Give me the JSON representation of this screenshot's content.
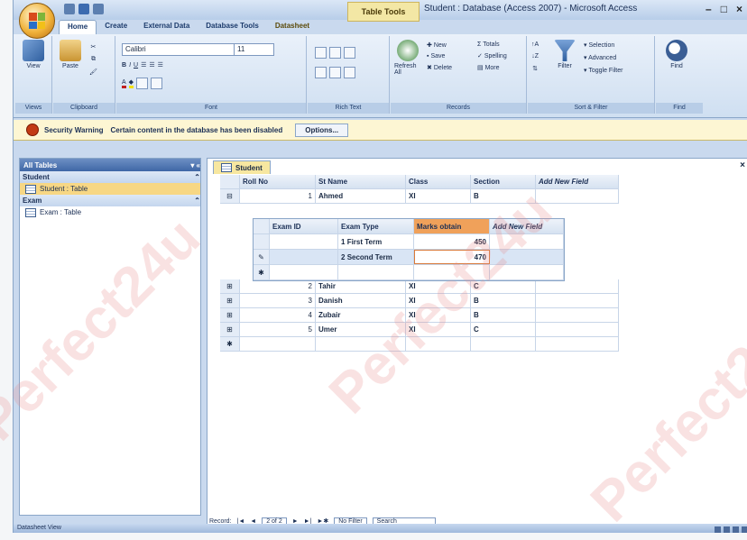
{
  "window": {
    "context_tab": "Table Tools",
    "title": "Student : Database (Access 2007) - Microsoft Access"
  },
  "ribbon": {
    "tabs": [
      "Home",
      "Create",
      "External Data",
      "Database Tools",
      "Datasheet"
    ],
    "active_tab": "Home",
    "groups": [
      {
        "label": "Views",
        "buttons": [
          "View"
        ]
      },
      {
        "label": "Clipboard",
        "buttons": [
          "Paste"
        ]
      },
      {
        "label": "Font",
        "font_name": "Calibri",
        "font_size": "11"
      },
      {
        "label": "Rich Text"
      },
      {
        "label": "Records",
        "buttons": [
          "Refresh All",
          "New",
          "Save",
          "Delete",
          "Totals",
          "Spelling",
          "More"
        ]
      },
      {
        "label": "Sort & Filter",
        "buttons": [
          "Filter",
          "Selection",
          "Advanced",
          "Toggle Filter"
        ]
      },
      {
        "label": "Find",
        "buttons": [
          "Find"
        ]
      }
    ]
  },
  "security_bar": {
    "title": "Security Warning",
    "message": "Certain content in the database has been disabled",
    "button": "Options..."
  },
  "nav_pane": {
    "header": "All Tables",
    "groups": [
      {
        "name": "Student",
        "items": [
          "Student : Table"
        ]
      },
      {
        "name": "Exam",
        "items": [
          "Exam : Table"
        ]
      }
    ]
  },
  "document": {
    "tab": "Student",
    "main_columns": [
      "Roll No",
      "St Name",
      "Class",
      "Section",
      "Add New Field"
    ],
    "rows": [
      {
        "roll": "1",
        "name": "Ahmed",
        "class": "XI",
        "section": "B"
      },
      {
        "roll": "2",
        "name": "Tahir",
        "class": "XI",
        "section": "C"
      },
      {
        "roll": "3",
        "name": "Danish",
        "class": "XI",
        "section": "B"
      },
      {
        "roll": "4",
        "name": "Zubair",
        "class": "XI",
        "section": "B"
      },
      {
        "roll": "5",
        "name": "Umer",
        "class": "XI",
        "section": "C"
      }
    ],
    "sub_columns": [
      "Exam ID",
      "Exam Type",
      "Marks obtain",
      "Add New Field"
    ],
    "sub_rows": [
      {
        "id": "1",
        "type": "First Term",
        "marks": "450"
      },
      {
        "id": "2",
        "type": "Second Term",
        "marks": "470"
      }
    ],
    "record_nav": {
      "label": "Record:",
      "position": "2 of 2",
      "filter": "No Filter",
      "search": "Search"
    }
  },
  "status": {
    "text": "Datasheet View"
  },
  "watermark": "Perfect24u"
}
